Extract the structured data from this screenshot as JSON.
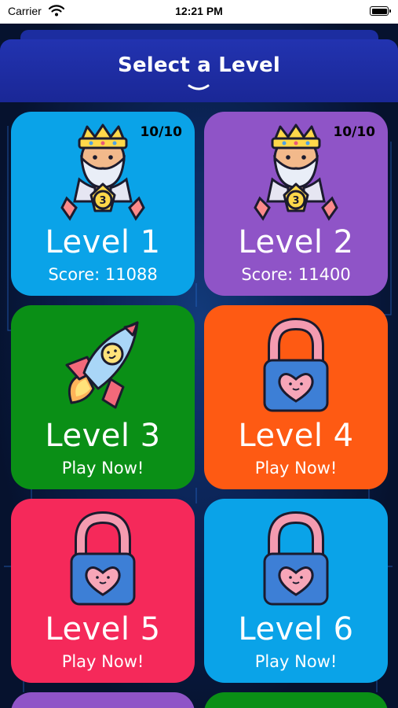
{
  "status_bar": {
    "carrier": "Carrier",
    "time": "12:21 PM"
  },
  "header": {
    "title": "Select a Level"
  },
  "colors": {
    "header": "#2233b0",
    "blue": "#0aa3e8",
    "purple": "#8f54c7",
    "green": "#0a8f16",
    "orange": "#fe5a13",
    "red": "#f5295a"
  },
  "levels": [
    {
      "label": "Level 1",
      "sub": "Score: 11088",
      "badge": "10/10",
      "icon": "king-trophy-icon",
      "color": "#0aa3e8",
      "medal": "3"
    },
    {
      "label": "Level 2",
      "sub": "Score: 11400",
      "badge": "10/10",
      "icon": "king-trophy-icon",
      "color": "#8f54c7",
      "medal": "3"
    },
    {
      "label": "Level 3",
      "sub": "Play Now!",
      "icon": "rocket-icon",
      "color": "#0a8f16"
    },
    {
      "label": "Level 4",
      "sub": "Play Now!",
      "icon": "lock-icon",
      "color": "#fe5a13"
    },
    {
      "label": "Level 5",
      "sub": "Play Now!",
      "icon": "lock-icon",
      "color": "#f5295a"
    },
    {
      "label": "Level 6",
      "sub": "Play Now!",
      "icon": "lock-icon",
      "color": "#0aa3e8"
    }
  ]
}
